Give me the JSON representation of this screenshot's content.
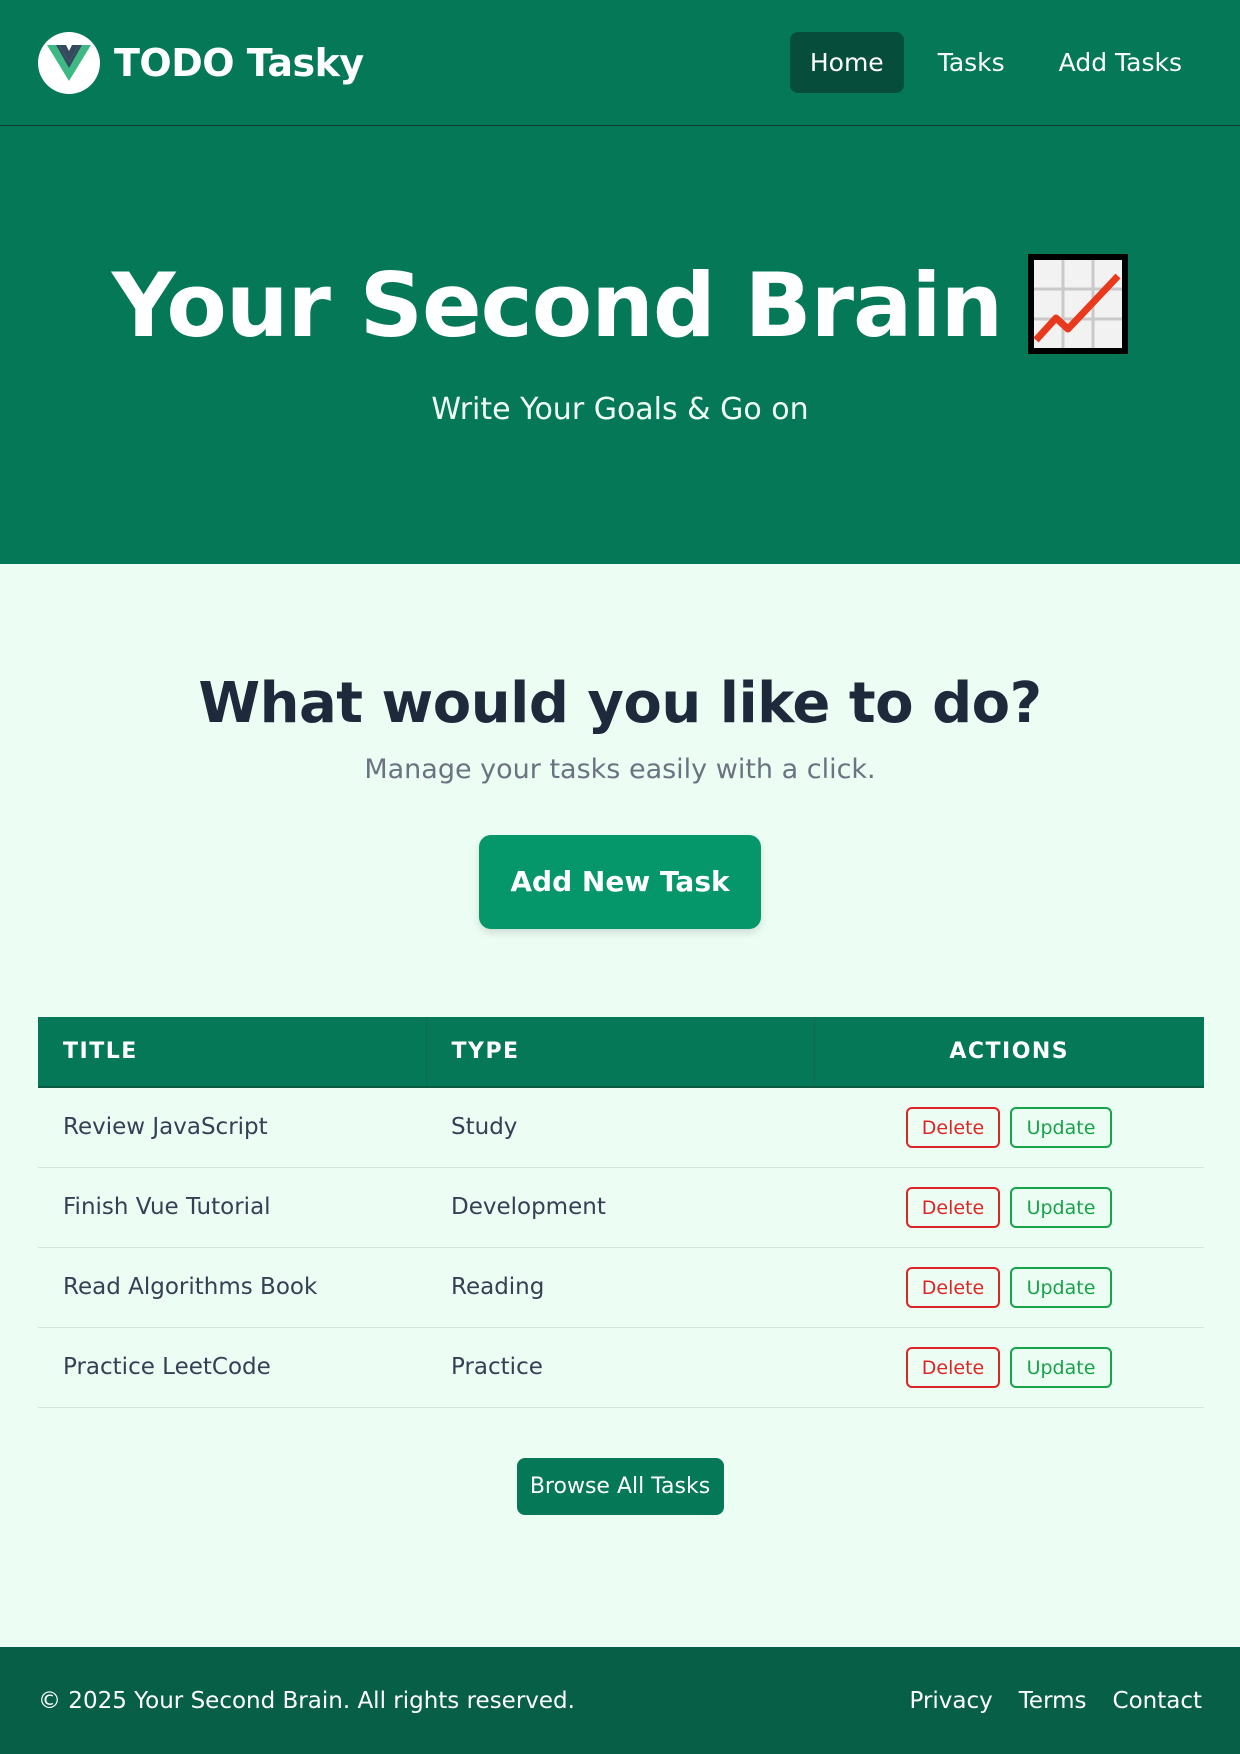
{
  "brand": {
    "name": "TODO Tasky",
    "logo_icon": "vue-logo-icon"
  },
  "nav": {
    "links": [
      {
        "label": "Home",
        "active": true
      },
      {
        "label": "Tasks",
        "active": false
      },
      {
        "label": "Add Tasks",
        "active": false
      }
    ]
  },
  "hero": {
    "title": "Your Second Brain",
    "emoji_icon": "chart-increasing-icon",
    "subtitle": "Write Your Goals & Go on"
  },
  "main": {
    "question": "What would you like to do?",
    "subtitle": "Manage your tasks easily with a click.",
    "add_button": "Add New Task",
    "browse_button": "Browse All Tasks"
  },
  "table": {
    "headers": [
      "TITLE",
      "TYPE",
      "ACTIONS"
    ],
    "rows": [
      {
        "title": "Review JavaScript",
        "type": "Study",
        "delete": "Delete",
        "update": "Update"
      },
      {
        "title": "Finish Vue Tutorial",
        "type": "Development",
        "delete": "Delete",
        "update": "Update"
      },
      {
        "title": "Read Algorithms Book",
        "type": "Reading",
        "delete": "Delete",
        "update": "Update"
      },
      {
        "title": "Practice LeetCode",
        "type": "Practice",
        "delete": "Delete",
        "update": "Update"
      }
    ]
  },
  "footer": {
    "copyright": "© 2025 Your Second Brain. All rights reserved.",
    "links": [
      "Privacy",
      "Terms",
      "Contact"
    ]
  },
  "colors": {
    "primary": "#047857",
    "accent": "#059669",
    "footer": "#065f46",
    "background": "#ecfdf3",
    "danger": "#dc2626",
    "success": "#16a34a"
  }
}
